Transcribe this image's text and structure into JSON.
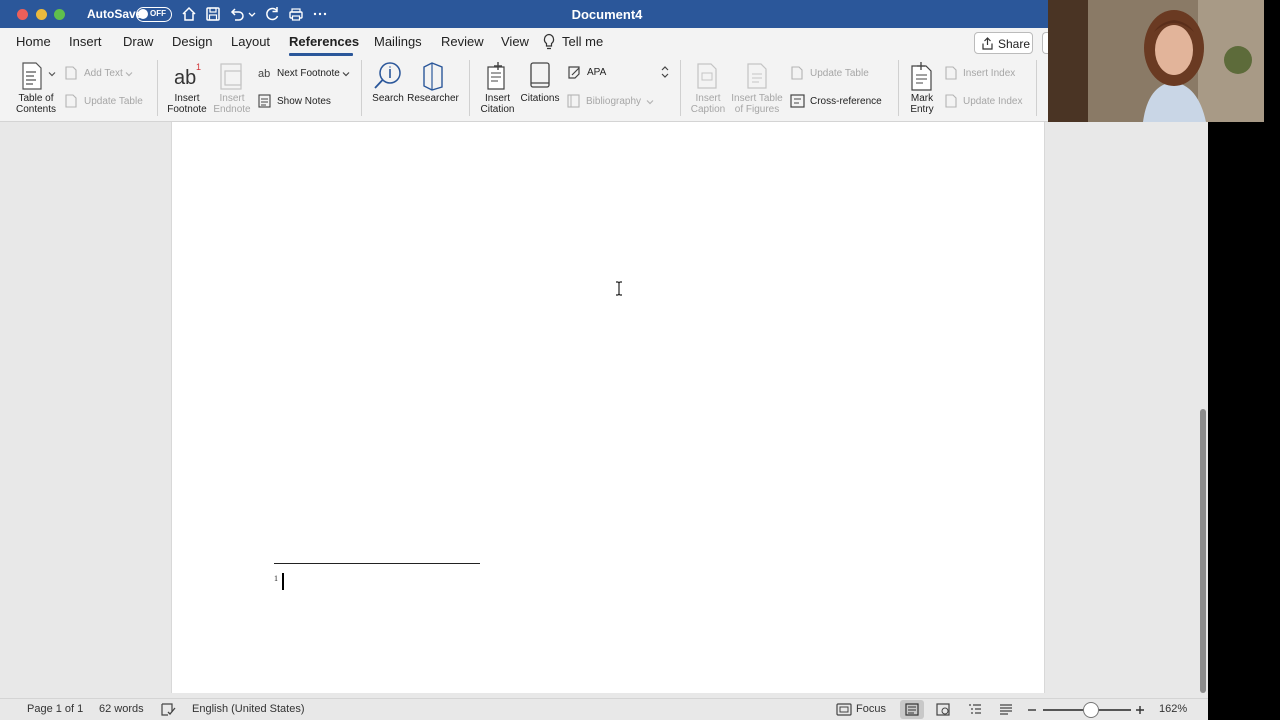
{
  "titlebar": {
    "autosave_label": "AutoSave",
    "autosave_state": "OFF",
    "document_title": "Document4",
    "bg_color": "#2b579a"
  },
  "tabs": [
    {
      "label": "Home"
    },
    {
      "label": "Insert"
    },
    {
      "label": "Draw"
    },
    {
      "label": "Design"
    },
    {
      "label": "Layout"
    },
    {
      "label": "References",
      "active": true
    },
    {
      "label": "Mailings"
    },
    {
      "label": "Review"
    },
    {
      "label": "View"
    },
    {
      "label": "Tell me"
    }
  ],
  "share_label": "Share",
  "ribbon": {
    "toc_label": "Table of Contents",
    "add_text": "Add Text",
    "update_table_1": "Update Table",
    "insert_footnote": "Insert Footnote",
    "insert_endnote": "Insert Endnote",
    "next_footnote": "Next Footnote",
    "show_notes": "Show Notes",
    "search": "Search",
    "researcher": "Researcher",
    "insert_citation": "Insert Citation",
    "citations": "Citations",
    "style_value": "APA",
    "bibliography": "Bibliography",
    "insert_caption": "Insert Caption",
    "insert_table_of_figures": "Insert Table of Figures",
    "update_table_2": "Update Table",
    "cross_reference": "Cross-reference",
    "mark_entry": "Mark Entry",
    "insert_index": "Insert Index",
    "update_index": "Update Index"
  },
  "document": {
    "footnote_number": "1"
  },
  "statusbar": {
    "page": "Page 1 of 1",
    "words": "62 words",
    "language": "English (United States)",
    "focus": "Focus",
    "zoom": "162%",
    "zoom_level_fraction": 0.55
  }
}
